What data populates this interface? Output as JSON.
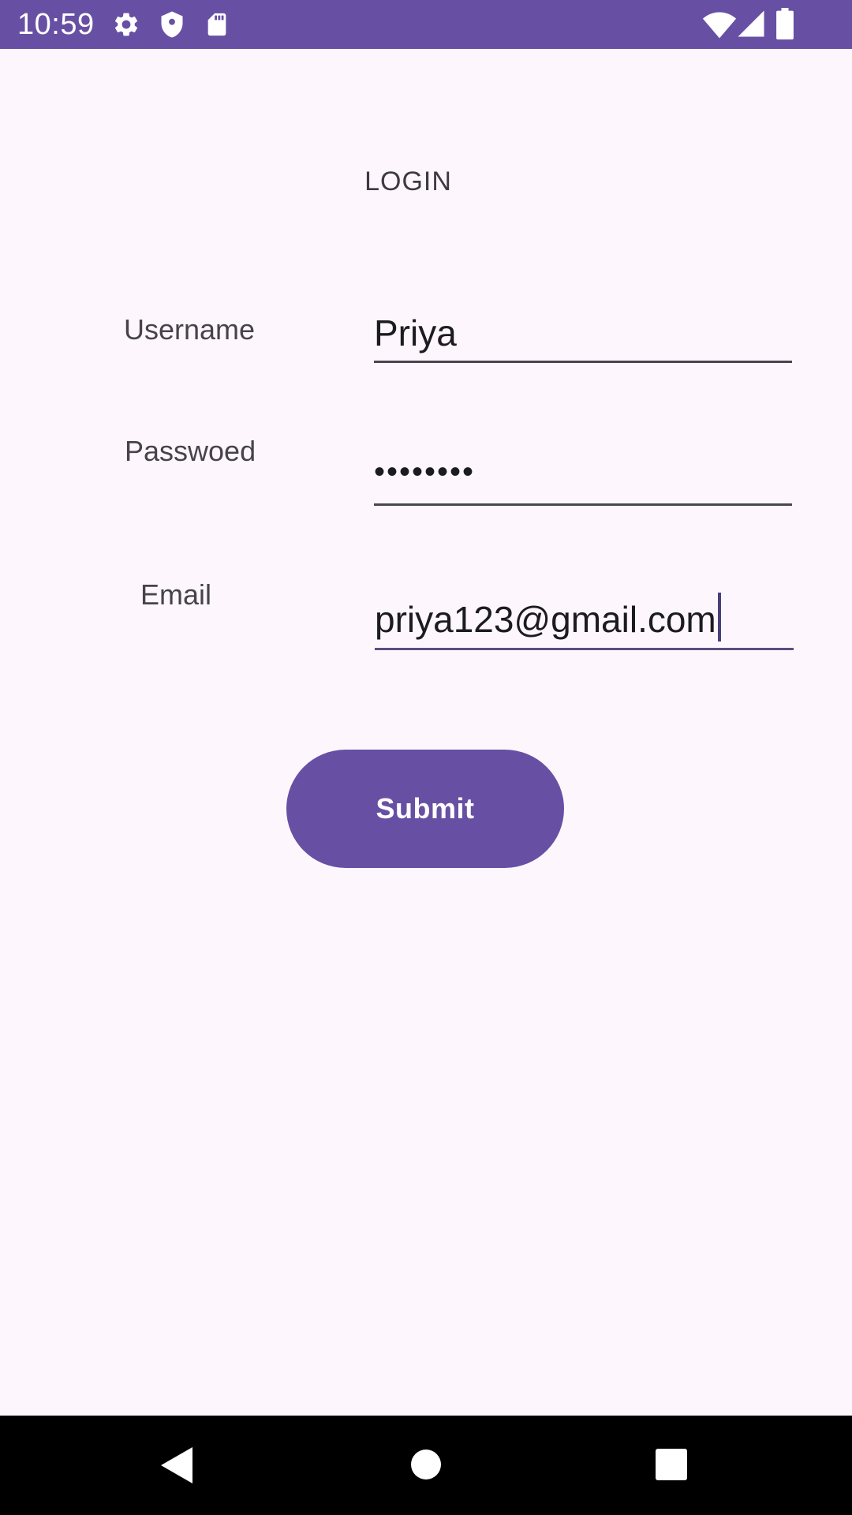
{
  "status_bar": {
    "time": "10:59",
    "left_icons": [
      "gear-icon",
      "shield-icon",
      "sd-card-icon"
    ],
    "right_icons": [
      "wifi-icon",
      "signal-icon",
      "battery-icon"
    ],
    "background": "#6750A4"
  },
  "login": {
    "title": "LOGIN",
    "username_label": "Username",
    "username_value": "Priya",
    "password_label": "Passwoed",
    "password_value": "••••••••",
    "email_label": "Email",
    "email_value": "priya123@gmail.com",
    "submit_label": "Submit"
  },
  "nav_bar": {
    "icons": [
      "back-icon",
      "home-icon",
      "recents-icon"
    ]
  },
  "colors": {
    "accent": "#6750A4",
    "background": "#FDF7FD"
  }
}
